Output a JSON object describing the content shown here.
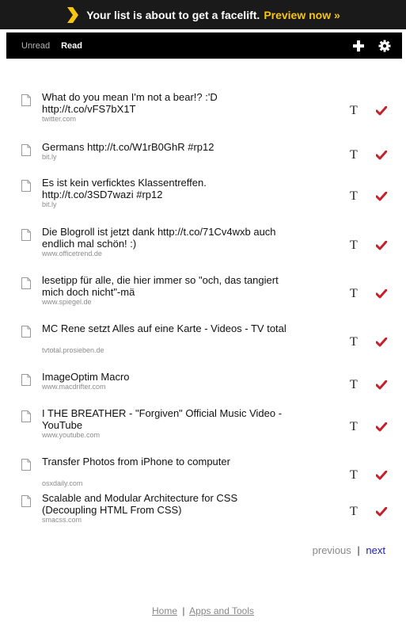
{
  "banner": {
    "message": "Your list is about to get a facelift.",
    "cta": "Preview now »",
    "icon": "chevron-right-icon",
    "accent_color": "#f7c410"
  },
  "nav": {
    "tabs": [
      {
        "label": "Unread",
        "active": false
      },
      {
        "label": "Read",
        "active": true
      }
    ],
    "icons": [
      "plus-icon",
      "gear-icon"
    ]
  },
  "items": [
    {
      "title": "What do you mean I'm not a bear!? :'D http://t.co/vFS7bX1T",
      "domain": "twitter.com"
    },
    {
      "title": "Germans http://t.co/W1rB0GhR #rp12",
      "domain": "bit.ly"
    },
    {
      "title": "Es ist kein verficktes Klassentreffen. http://t.co/3SD7wazi #rp12",
      "domain": "bit.ly"
    },
    {
      "title": "Die Blogroll ist jetzt dank http://t.co/71Cv4wxb auch endlich mal schön! :)",
      "domain": "www.officetrend.de"
    },
    {
      "title": "lesetipp für alle, die hier immer so \"och, das tangiert mich doch nicht\"-mä",
      "domain": "www.spiegel.de"
    },
    {
      "title": "MC Rene setzt Alles auf eine Karte - Videos - TV total",
      "domain": "tvtotal.prosieben.de"
    },
    {
      "title": "ImageOptim Macro",
      "domain": "www.macdrifter.com"
    },
    {
      "title": "I THE BREATHER - \"Forgiven\" Official Music Video - YouTube",
      "domain": "www.youtube.com"
    },
    {
      "title": "Transfer Photos from iPhone to computer",
      "domain": "osxdaily.com"
    },
    {
      "title": "Scalable and Modular Architecture for CSS (Decoupling HTML From CSS)",
      "domain": "smacss.com"
    }
  ],
  "item_actions": {
    "text_label": "T",
    "check_color": "#c8202a"
  },
  "pager": {
    "previous": "previous",
    "separator": "|",
    "next": "next"
  },
  "footer": {
    "home": "Home",
    "separator": "|",
    "apps": "Apps and Tools"
  }
}
